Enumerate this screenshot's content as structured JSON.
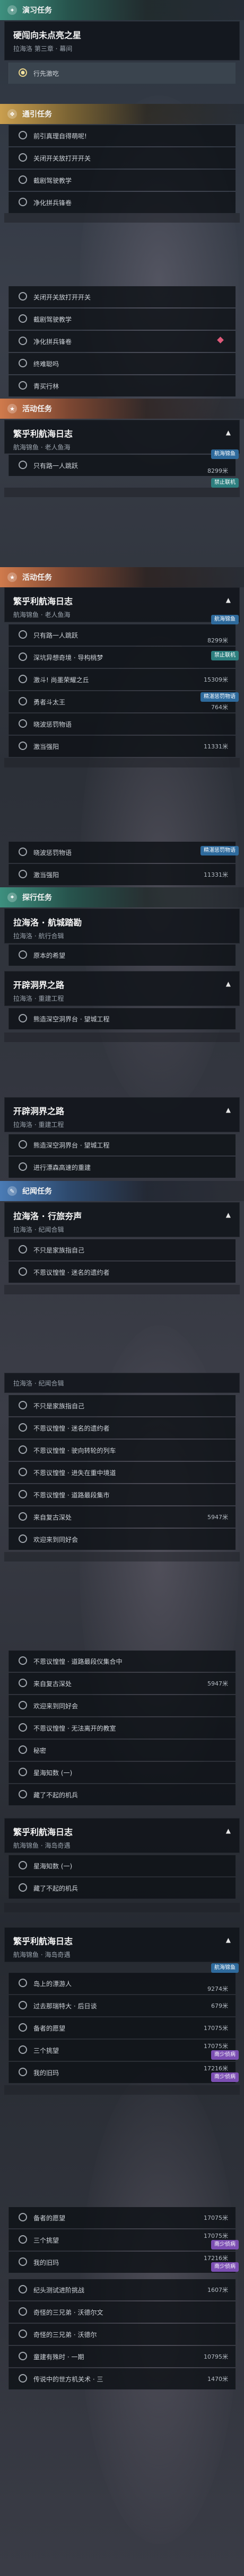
{
  "s1": {
    "main_header": "演习任务",
    "card1": {
      "title": "硬闯向未点亮之星",
      "sub": "拉海洛 第三章 · 幕间"
    },
    "card1_item": "行先激吃",
    "side_header": "通引任务",
    "side_items": [
      "前引真理自得萌呢!",
      "关闭开关放打开开关",
      "截剧驾驶教学",
      "净化拼兵锋卷"
    ]
  },
  "s2": {
    "items": [
      "关闭开关放打开开关",
      "截剧驾驶教学",
      "净化拼兵锋卷",
      "终难聪吗",
      "青买行林"
    ],
    "event_header": "活动任务",
    "card2": {
      "title": "繁乎利航海日志",
      "sub": "航海锦鱼 · 老人鱼海"
    },
    "card2_item": "只有路一人跳跃",
    "card2_item_right": "8299米",
    "badge_a": "航海锦鱼",
    "badge_b": "禁止联机"
  },
  "s3": {
    "event_header": "活动任务",
    "card": {
      "title": "繁乎利航海日志",
      "sub": "航海锦鱼 · 老人鱼海"
    },
    "items": [
      {
        "text": "只有路一人跳跃",
        "right": "8299米",
        "badge": ""
      },
      {
        "text": "深坑异想奇境 · 导构桃梦",
        "right": "",
        "badge": "禁止联机"
      },
      {
        "text": "激斗! 尚墨荣耀之丘",
        "right": "15309米",
        "badge": ""
      },
      {
        "text": "勇者斗太王",
        "right": "764米",
        "badge": "精湛惩罚物语"
      },
      {
        "text": "晓波惩罚物语",
        "right": "",
        "badge": ""
      },
      {
        "text": "激当强阳",
        "right": "11331米",
        "badge": ""
      }
    ],
    "badge_top": "航海锦鱼"
  },
  "s4": {
    "items": [
      {
        "text": "晓波惩罚物语",
        "right": "",
        "badge": "精湛惩罚物语"
      },
      {
        "text": "激当强阳",
        "right": "11331米",
        "badge": ""
      }
    ],
    "explore_header": "探行任务",
    "card1": {
      "title": "拉海洛 · 航城踏勘",
      "sub": "拉海洛 · 航行合辑"
    },
    "card1_item": "原本的希望",
    "card2": {
      "title": "开辟洞界之路",
      "sub": "拉海洛 · 重建工程"
    },
    "card2_item": "熊造深空洞界台 · 望城工程"
  },
  "s5": {
    "card1": {
      "title": "开辟洞界之路",
      "sub": "拉海洛 · 重建工程"
    },
    "items1": [
      "熊造深空洞界台 · 望城工程",
      "进行漂森高速的重建"
    ],
    "record_header": "纪闻任务",
    "card2": {
      "title": "拉海洛 · 行旅夯声",
      "sub": "拉海洛 · 纪闻合辑"
    },
    "items2": [
      "不只是家族指自己",
      "不恩议惶惶 · 迷名的遗约者"
    ]
  },
  "s6": {
    "card_sub": "拉海洛 · 纪闻合辑",
    "items": [
      {
        "text": "不只是家族指自己",
        "right": ""
      },
      {
        "text": "不恩议惶惶 · 迷名的遗约者",
        "right": ""
      },
      {
        "text": "不恩议惶惶 · 驶向转轮的列车",
        "right": ""
      },
      {
        "text": "不恩议惶惶 · 进失在重中境道",
        "right": ""
      },
      {
        "text": "不恩议惶惶 · 道路最段集市",
        "right": ""
      },
      {
        "text": "来自复古深处",
        "right": "5947米"
      },
      {
        "text": "欢迎来到同好会",
        "right": ""
      }
    ]
  },
  "s7": {
    "items": [
      {
        "text": "不恩议惶惶 · 道路最段仪集合中",
        "right": ""
      },
      {
        "text": "来自复古深处",
        "right": "5947米"
      },
      {
        "text": "欢迎来到同好会",
        "right": ""
      },
      {
        "text": "不恩议惶惶 · 无法离开的教室",
        "right": ""
      },
      {
        "text": "秘密",
        "right": ""
      },
      {
        "text": "星海知数 (一)",
        "right": ""
      },
      {
        "text": "藏了不起的机兵",
        "right": ""
      }
    ],
    "card": {
      "title": "繁乎利航海日志",
      "sub": "航海锦鱼 · 海岛奇遇"
    },
    "card_items": [
      "星海知数 (一)",
      "藏了不起的机兵"
    ]
  },
  "s8": {
    "card": {
      "title": "繁乎利航海日志",
      "sub": "航海锦鱼 · 海岛奇遇"
    },
    "items": [
      {
        "text": "岛上的漂游人",
        "right": "9274米",
        "badge": "航海锦鱼"
      },
      {
        "text": "过去那瑞特大 · 后日谈",
        "right": "679米",
        "badge": ""
      },
      {
        "text": "备者的愿望",
        "right": "17075米",
        "badge": ""
      },
      {
        "text": "三个挑望",
        "right": "17075米",
        "badge": "南少侦病"
      },
      {
        "text": "我的旧玛",
        "right": "17216米",
        "badge": "南少侦病"
      }
    ]
  },
  "s9": {
    "items": [
      {
        "text": "备者的愿望",
        "right": "17075米",
        "badge": ""
      },
      {
        "text": "三个挑望",
        "right": "17075米",
        "badge": "南少侦病"
      },
      {
        "text": "我的旧玛",
        "right": "17216米",
        "badge": "南少侦病"
      },
      {
        "text": "纪头测试进阶挑战",
        "right": "1607米",
        "badge": ""
      },
      {
        "text": "奇怪的三兄弟 · 沃德尔文",
        "right": "",
        "badge": ""
      },
      {
        "text": "奇怪的三兄弟 · 沃德尔",
        "right": "",
        "badge": ""
      },
      {
        "text": "童建有殊时 · 一期",
        "right": "10795米",
        "badge": ""
      },
      {
        "text": "传说中的世方机关术 · 三",
        "right": "1470米",
        "badge": ""
      }
    ]
  }
}
